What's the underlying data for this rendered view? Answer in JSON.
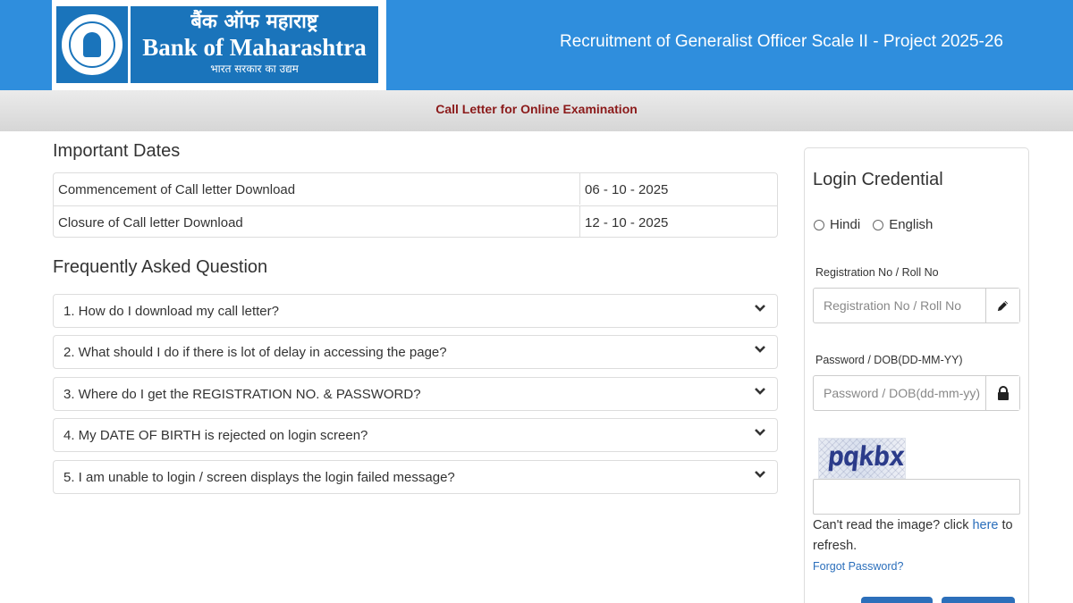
{
  "header": {
    "bank_name_hindi": "बैंक ऑफ महाराष्ट्र",
    "bank_name_english": "Bank of Maharashtra",
    "tagline_hindi": "भारत सरकार का उद्यम",
    "title": "Recruitment of Generalist Officer Scale II - Project 2025-26"
  },
  "subbar": {
    "title": "Call Letter for Online Examination"
  },
  "important_dates": {
    "heading": "Important Dates",
    "rows": [
      {
        "label": "Commencement of Call letter Download",
        "value": "06 - 10 - 2025"
      },
      {
        "label": "Closure of Call letter Download",
        "value": "12 - 10 - 2025"
      }
    ]
  },
  "faq": {
    "heading": "Frequently Asked Question",
    "items": [
      "1. How do I download my call letter?",
      "2. What should I do if there is lot of delay in accessing the page?",
      "3. Where do I get the REGISTRATION NO. & PASSWORD?",
      "4. My DATE OF BIRTH is rejected on login screen?",
      "5. I am unable to login / screen displays the login failed message?"
    ]
  },
  "login": {
    "title": "Login Credential",
    "languages": [
      "Hindi",
      "English"
    ],
    "registration": {
      "label": "Registration No / Roll No",
      "placeholder": "Registration No / Roll No",
      "value": ""
    },
    "password": {
      "label": "Password / DOB(DD-MM-YY)",
      "placeholder": "Password / DOB(dd-mm-yy)",
      "value": ""
    },
    "captcha": {
      "text": "pqkbx",
      "input_value": ""
    },
    "captcha_help_prefix": "Can't read the image? click ",
    "captcha_help_link": "here",
    "captcha_help_suffix": " to refresh.",
    "forgot_password": "Forgot Password?"
  },
  "icons": {
    "registration_addon": "pencil-icon",
    "password_addon": "lock-icon",
    "faq_toggle": "chevron-down-icon"
  },
  "colors": {
    "header_blue": "#2f8edd",
    "logo_blue": "#1a74bb",
    "subbar_title": "#8b1a1a",
    "link": "#2a6ebb",
    "button": "#2c6fba"
  }
}
